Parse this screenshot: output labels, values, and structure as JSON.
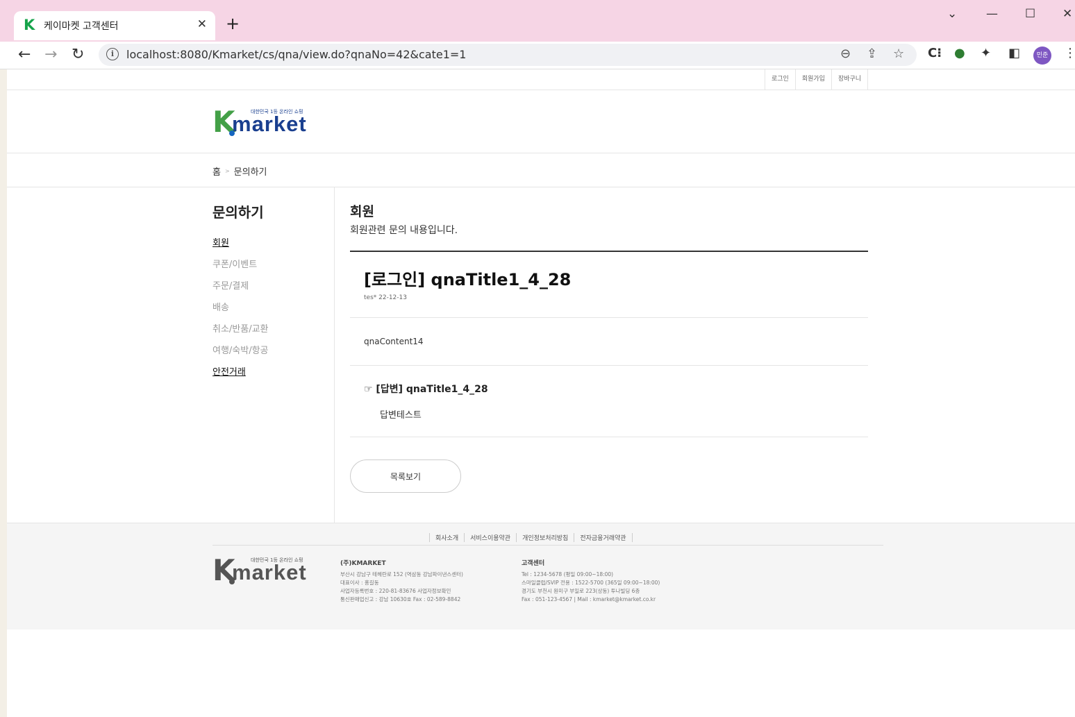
{
  "browser": {
    "tab_title": "케이마켓 고객센터",
    "tab_favicon": "K",
    "url": "localhost:8080/Kmarket/cs/qna/view.do?qnaNo=42&cate1=1",
    "profile_label": "민준"
  },
  "top_links": [
    "로그인",
    "회원가입",
    "장바구니"
  ],
  "logo": {
    "k": "K",
    "text": "market",
    "tagline": "대한민국 1등 온라인 쇼핑"
  },
  "breadcrumb": {
    "home": "홈",
    "current": "문의하기"
  },
  "sidebar": {
    "title": "문의하기",
    "items": [
      {
        "label": "회원",
        "active": true
      },
      {
        "label": "쿠폰/이벤트",
        "active": false
      },
      {
        "label": "주문/결제",
        "active": false
      },
      {
        "label": "배송",
        "active": false
      },
      {
        "label": "취소/반품/교환",
        "active": false
      },
      {
        "label": "여행/숙박/항공",
        "active": false
      },
      {
        "label": "안전거래",
        "active": true
      }
    ]
  },
  "content": {
    "category_title": "회원",
    "category_desc": "회원관련 문의 내용입니다.",
    "qna_title": "[로그인] qnaTitle1_4_28",
    "meta": "tes* 22-12-13",
    "body": "qnaContent14",
    "answer_title": "☞ [답변] qnaTitle1_4_28",
    "answer_body": "답변테스트",
    "list_button": "목록보기"
  },
  "footer": {
    "links": [
      "회사소개",
      "서비스이용약관",
      "개인정보처리방침",
      "전자금융거래약관"
    ],
    "company": {
      "name": "(주)KMARKET",
      "lines": [
        "부산시 강남구 테헤란로 152 (역삼동 강남파이낸스센터)",
        "대표이사 : 홍길동",
        "사업자등록번호 : 220-81-83676 사업자정보확인",
        "통신판매업신고 : 강남 10630호 Fax : 02-589-8842"
      ]
    },
    "cs": {
      "name": "고객센터",
      "lines": [
        "Tel : 1234-5678 (평일 09:00~18:00)",
        "스마일클럽/SVIP 전용 : 1522-5700 (365일 09:00~18:00)",
        "경기도 부천시 원미구 부일로 223(상동) 투나빌딩 6층",
        "Fax : 051-123-4567 | Mail : kmarket@kmarket.co.kr"
      ]
    }
  },
  "colors": {
    "tabbar": "#f6d5e5",
    "logo_green": "#43a047",
    "logo_blue": "#1a3f8f"
  }
}
